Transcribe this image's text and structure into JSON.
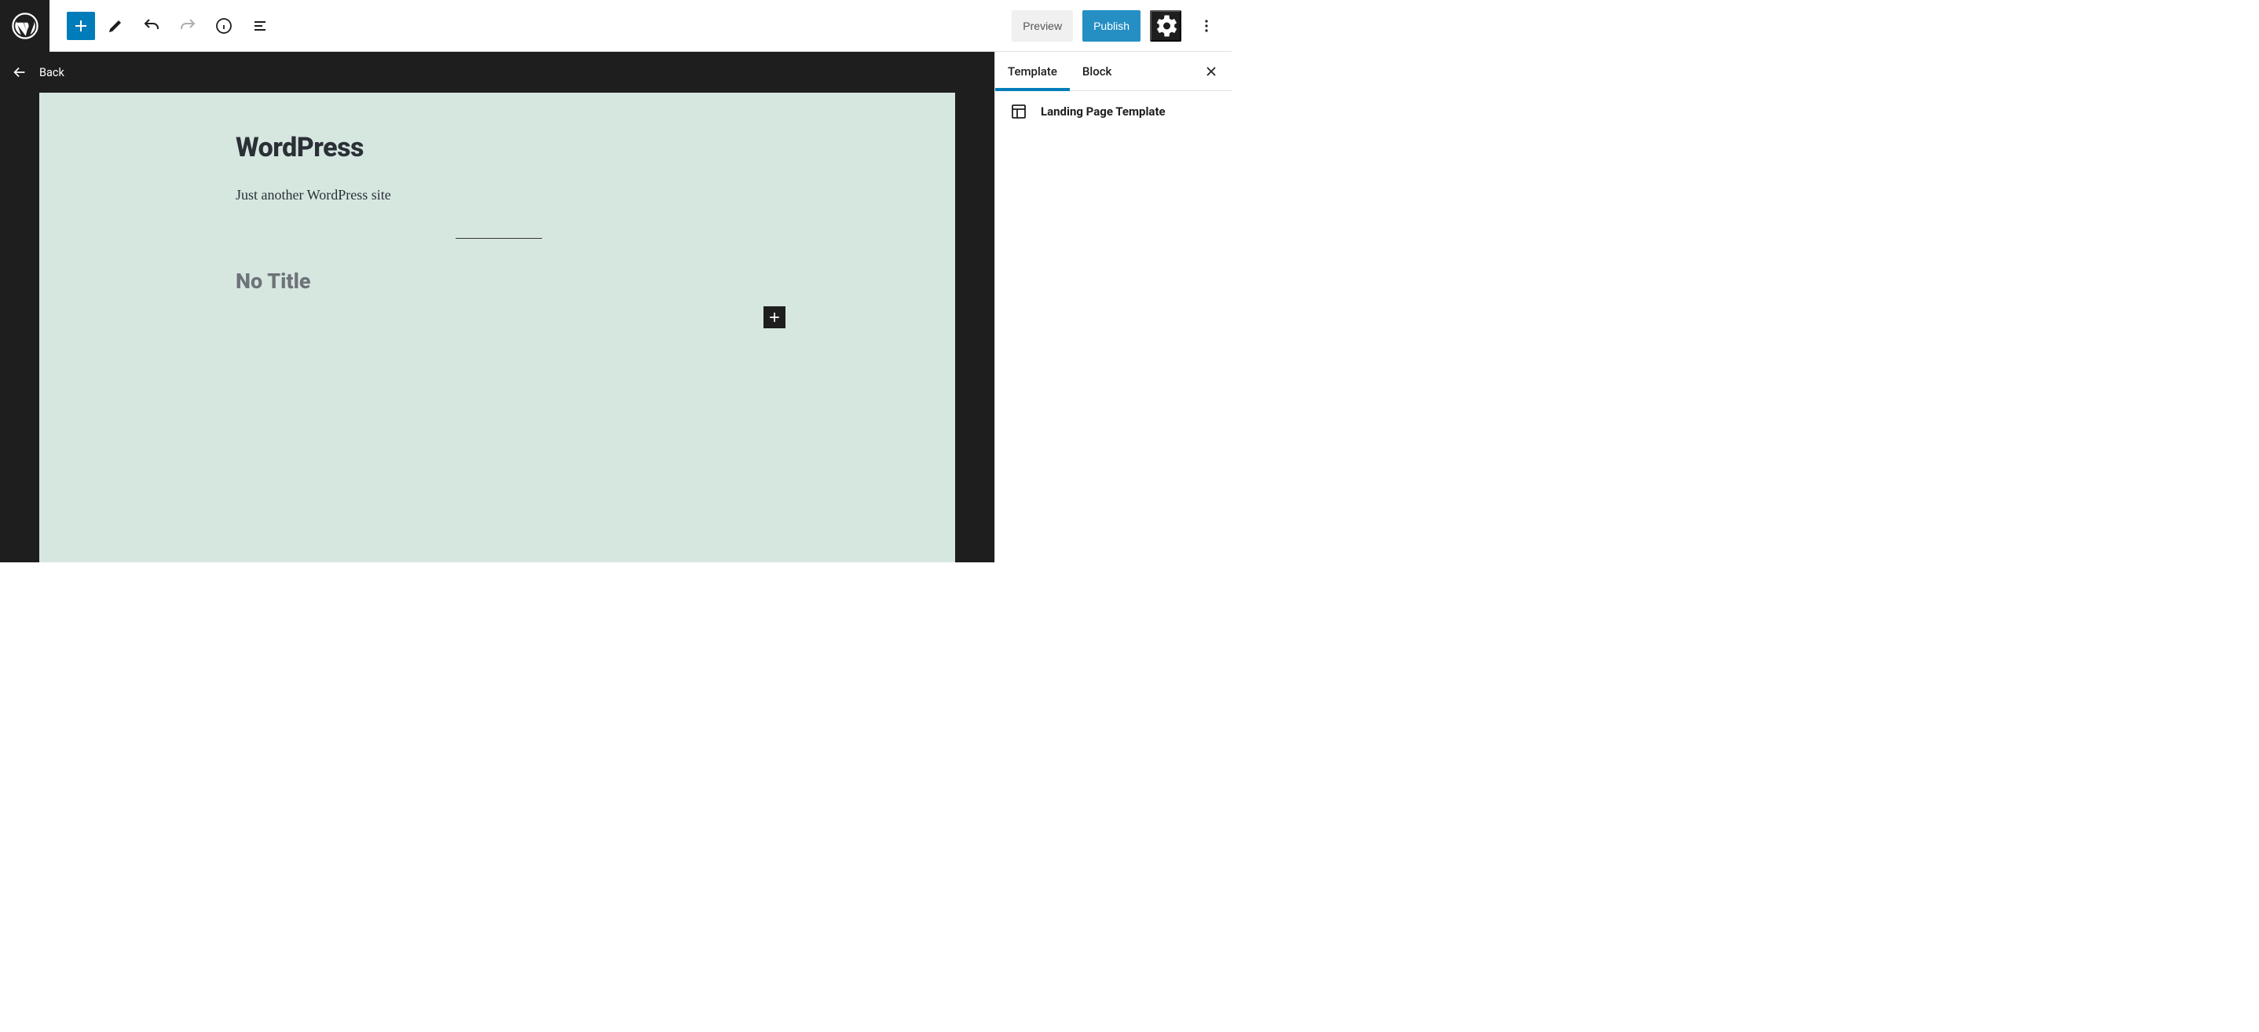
{
  "toolbar": {
    "preview_label": "Preview",
    "publish_label": "Publish"
  },
  "back": {
    "label": "Back"
  },
  "canvas": {
    "site_title": "WordPress",
    "tagline": "Just another WordPress site",
    "no_title": "No Title"
  },
  "sidebar": {
    "tabs": {
      "template": "Template",
      "block": "Block"
    },
    "template_name": "Landing Page Template"
  }
}
